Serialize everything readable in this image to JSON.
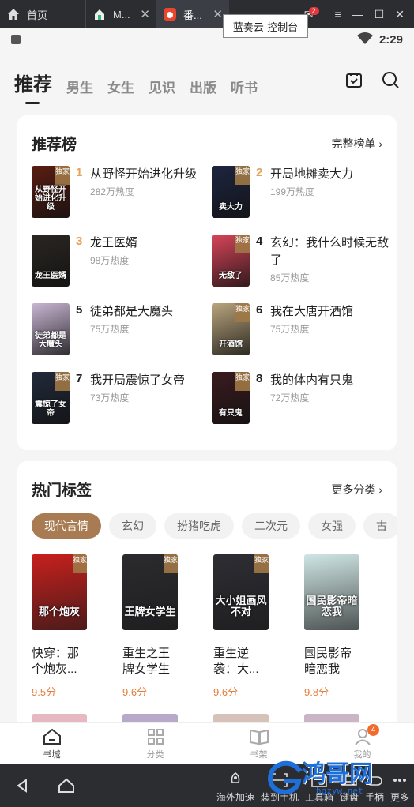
{
  "emulator": {
    "tabs": [
      {
        "label": "首页"
      },
      {
        "label": "M..."
      },
      {
        "label": "番..."
      }
    ],
    "notification_count": "2",
    "tooltip": "蓝奏云-控制台",
    "bottom_tools": [
      "海外加速",
      "装到手机",
      "工具箱",
      "键盘",
      "手柄",
      "更多"
    ]
  },
  "status_bar": {
    "time": "2:29"
  },
  "header": {
    "tabs": [
      "推荐",
      "男生",
      "女生",
      "见识",
      "出版",
      "听书"
    ]
  },
  "ranking": {
    "title": "推荐榜",
    "more": "完整榜单 ›",
    "items": [
      {
        "rank": "1",
        "title": "从野怪开始进化升级",
        "heat": "282万热度",
        "badge": "独家",
        "cover_text": "从野怪开始进化升级",
        "cover_color": "#5a1d12"
      },
      {
        "rank": "2",
        "title": "开局地摊卖大力",
        "heat": "199万热度",
        "badge": "独家",
        "cover_text": "卖大力",
        "cover_color": "#1d2540"
      },
      {
        "rank": "3",
        "title": "龙王医婿",
        "heat": "98万热度",
        "badge": "",
        "cover_text": "龙王医婿",
        "cover_color": "#2a2622"
      },
      {
        "rank": "4",
        "title": "玄幻：我什么时候无敌了",
        "heat": "85万热度",
        "badge": "独家",
        "cover_text": "无敌了",
        "cover_color": "#d8455a"
      },
      {
        "rank": "5",
        "title": "徒弟都是大魔头",
        "heat": "75万热度",
        "badge": "",
        "cover_text": "徒弟都是大魔头",
        "cover_color": "#c9b6d3"
      },
      {
        "rank": "6",
        "title": "我在大唐开酒馆",
        "heat": "75万热度",
        "badge": "独家",
        "cover_text": "开酒馆",
        "cover_color": "#b9a57d"
      },
      {
        "rank": "7",
        "title": "我开局震惊了女帝",
        "heat": "73万热度",
        "badge": "独家",
        "cover_text": "震惊了女帝",
        "cover_color": "#222a3a"
      },
      {
        "rank": "8",
        "title": "我的体内有只鬼",
        "heat": "72万热度",
        "badge": "独家",
        "cover_text": "有只鬼",
        "cover_color": "#3a1b1f"
      }
    ]
  },
  "hot_tags": {
    "title": "热门标签",
    "more": "更多分类 ›",
    "chips": [
      "现代言情",
      "玄幻",
      "扮猪吃虎",
      "二次元",
      "女强",
      "古"
    ],
    "books": [
      {
        "title": "快穿：那个炮灰...",
        "score": "9.5分",
        "badge": "独家",
        "cover_text": "那个炮灰",
        "cover_color": "#c7201d"
      },
      {
        "title": "重生之王牌女学生",
        "score": "9.6分",
        "badge": "独家",
        "cover_text": "王牌女学生",
        "cover_color": "#2b2a2e"
      },
      {
        "title": "重生逆袭：大...",
        "score": "9.6分",
        "badge": "独家",
        "cover_text": "大小姐画风不对",
        "cover_color": "#2d2d33"
      },
      {
        "title": "国民影帝暗恋我",
        "score": "9.8分",
        "badge": "",
        "cover_text": "国民影帝暗恋我",
        "cover_color": "#cfe6e4"
      }
    ],
    "peek_colors": [
      "#e6b9c2",
      "#b8a8c9",
      "#d7c2b9",
      "#c9b5c6"
    ]
  },
  "app_nav": {
    "items": [
      "书城",
      "分类",
      "书架",
      "我的"
    ],
    "mine_badge": "4"
  },
  "watermark": {
    "text": "鸿哥网",
    "sub": "hgzyw.net"
  }
}
